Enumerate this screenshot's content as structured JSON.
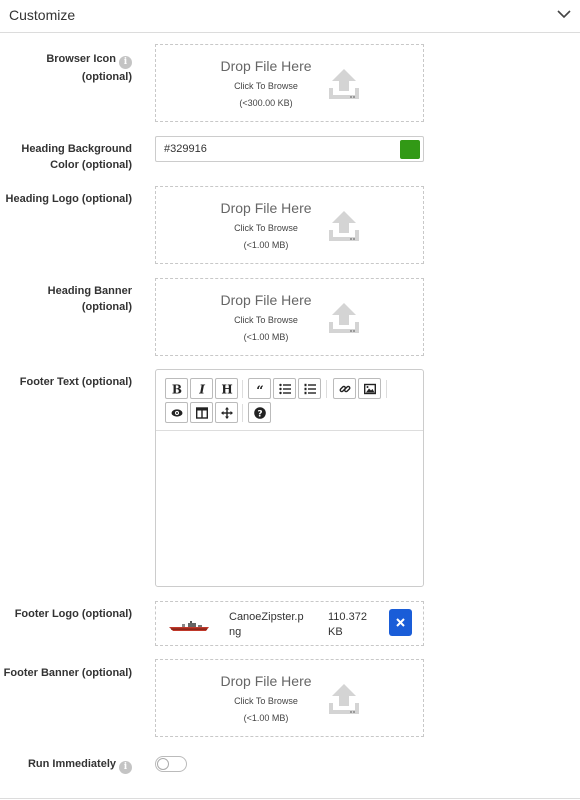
{
  "section": {
    "title": "Customize"
  },
  "fields": {
    "browser_icon": {
      "label": "Browser Icon",
      "optional": "(optional)"
    },
    "heading_bg_color": {
      "label": "Heading Background Color (optional)",
      "value": "#329916",
      "swatch": "#329916"
    },
    "heading_logo": {
      "label": "Heading Logo (optional)"
    },
    "heading_banner": {
      "label": "Heading Banner",
      "optional": "(optional)"
    },
    "footer_text": {
      "label": "Footer Text (optional)",
      "content": ""
    },
    "footer_logo": {
      "label": "Footer Logo (optional)"
    },
    "footer_banner": {
      "label": "Footer Banner (optional)"
    },
    "run_immediately": {
      "label": "Run Immediately",
      "enabled": false
    }
  },
  "dropzones": {
    "browser_icon": {
      "title": "Drop File Here",
      "browse": "Click To Browse",
      "limit": "(<300.00 KB)"
    },
    "heading_logo": {
      "title": "Drop File Here",
      "browse": "Click To Browse",
      "limit": "(<1.00 MB)"
    },
    "heading_banner": {
      "title": "Drop File Here",
      "browse": "Click To Browse",
      "limit": "(<1.00 MB)"
    },
    "footer_banner": {
      "title": "Drop File Here",
      "browse": "Click To Browse",
      "limit": "(<1.00 MB)"
    }
  },
  "footer_logo_file": {
    "name": "CanoeZipster.png",
    "size": "110.372 KB"
  },
  "editor_toolbar": {
    "buttons": [
      "bold-icon",
      "italic-icon",
      "heading-icon",
      "quote-icon",
      "unordered-list-icon",
      "ordered-list-icon",
      "link-icon",
      "image-icon",
      "preview-icon",
      "side-by-side-icon",
      "fullscreen-icon",
      "guide-icon"
    ]
  },
  "colors": {
    "accent": "#1a5dd8",
    "swatch": "#329916",
    "border": "#c8c8c8"
  }
}
